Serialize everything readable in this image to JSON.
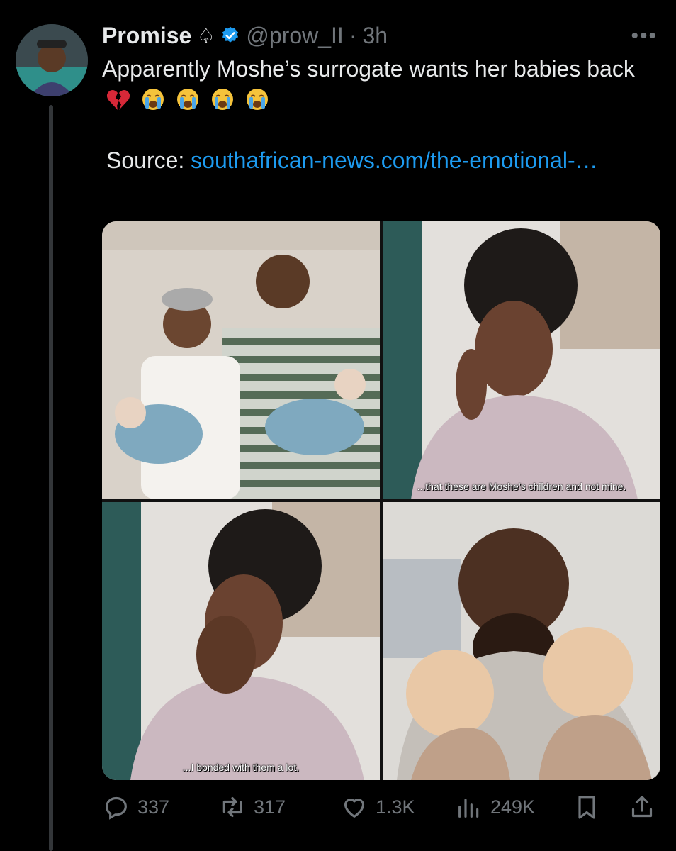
{
  "tweet": {
    "author_name": "Promise",
    "handle": "@prow_II",
    "separator": "·",
    "time": "3h",
    "text_line": "Apparently Moshe’s surrogate wants her babies back",
    "emojis": [
      "broken-heart",
      "loudly-crying",
      "loudly-crying",
      "loudly-crying",
      "loudly-crying"
    ],
    "source_label": "Source:",
    "source_link": "southafrican-news.com/the-emotional-…"
  },
  "media": {
    "captions": {
      "top_right": "...that these are Moshe’s children and not mine.",
      "bottom_left": "...I bonded with them a lot."
    }
  },
  "actions": {
    "replies": "337",
    "reposts": "317",
    "likes": "1.3K",
    "views": "249K"
  },
  "colors": {
    "background": "#000000",
    "text": "#e7e9ea",
    "muted": "#71767b",
    "link": "#1d9bf0",
    "verified": "#1d9bf0"
  }
}
